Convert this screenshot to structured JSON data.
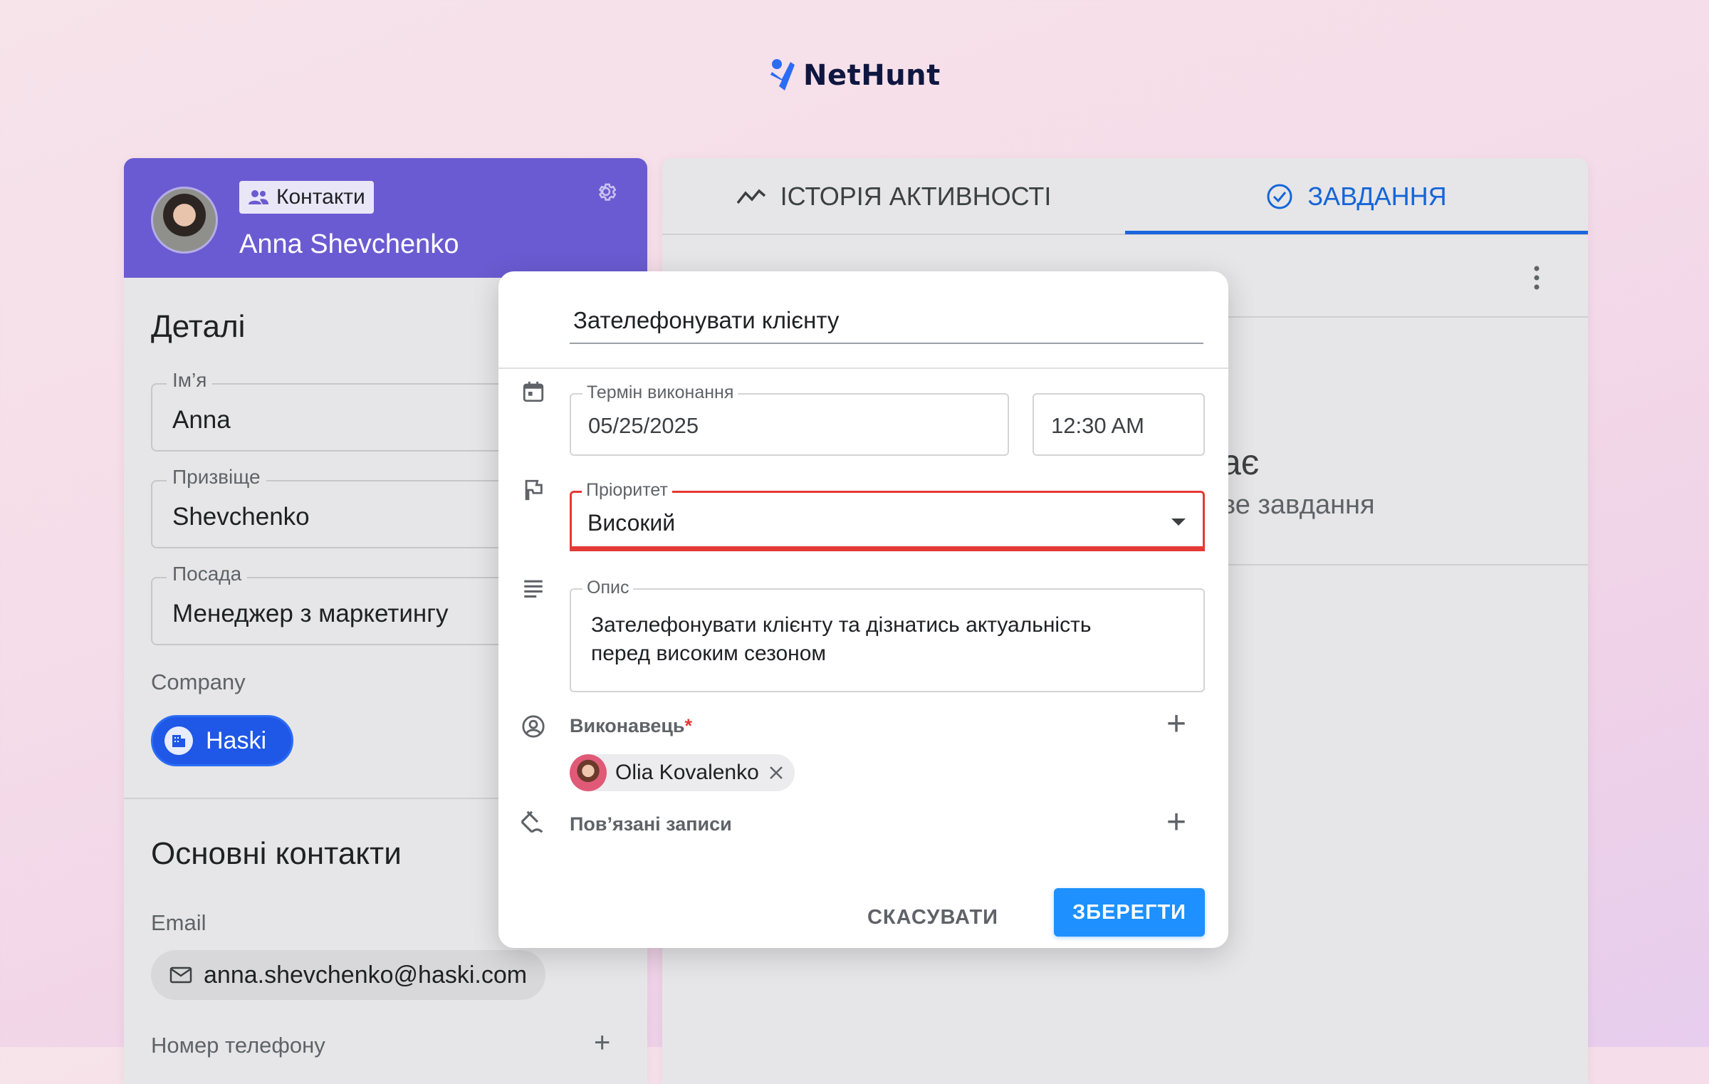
{
  "logo": {
    "text": "NetHunt"
  },
  "contact": {
    "badge_label": "Контакти",
    "name": "Anna Shevchenko"
  },
  "details": {
    "title": "Деталі",
    "fields": [
      {
        "label": "Ім’я",
        "value": "Anna"
      },
      {
        "label": "Призвіще",
        "value": "Shevchenko"
      },
      {
        "label": "Посада",
        "value": "Менеджер з маркетингу"
      }
    ],
    "company_label": "Company",
    "company_value": "Haski"
  },
  "main_contacts": {
    "title": "Основні контакти",
    "email_label": "Email",
    "email_value": "anna.shevchenko@haski.com",
    "phone_label": "Номер телефону"
  },
  "tabs": {
    "activity": "ІСТОРІЯ АКТИВНОСТІ",
    "tasks": "ЗАВДАННЯ"
  },
  "empty_state": {
    "title_fragment": "ає",
    "subtitle_fragment": "ве завдання"
  },
  "dialog": {
    "title": "Зателефонувати клієнту",
    "due_label": "Термін виконання",
    "due_date": "05/25/2025",
    "due_time": "12:30 AM",
    "priority_label": "Пріоритет",
    "priority_value": "Високий",
    "description_label": "Опис",
    "description_value": "Зателефонувати клієнту та дізнатись актуальність перед високим сезоном",
    "assignee_label": "Виконавець",
    "assignee_required_mark": "*",
    "assignee_name": "Olia Kovalenko",
    "related_label": "Пов’язані записи",
    "cancel_label": "СКАСУВАТИ",
    "save_label": "ЗБЕРЕГТИ"
  },
  "colors": {
    "header_purple": "#6a5bd2",
    "accent_blue": "#1565d8",
    "save_blue": "#1e90ff",
    "priority_red": "#e53935"
  }
}
